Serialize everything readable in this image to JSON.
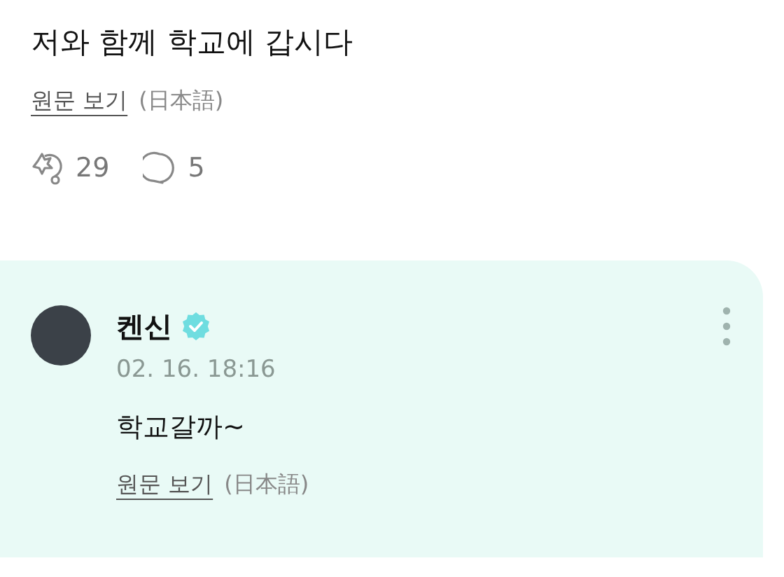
{
  "post": {
    "text": "저와 함께 학교에 갑시다",
    "original_link": "원문 보기",
    "original_language": "(日本語)",
    "reactions": "29",
    "comments": "5"
  },
  "reply": {
    "author": "켄신",
    "verified": true,
    "time": "02. 16. 18:16",
    "text": "학교갈까~",
    "original_link": "원문 보기",
    "original_language": "(日本語)"
  }
}
